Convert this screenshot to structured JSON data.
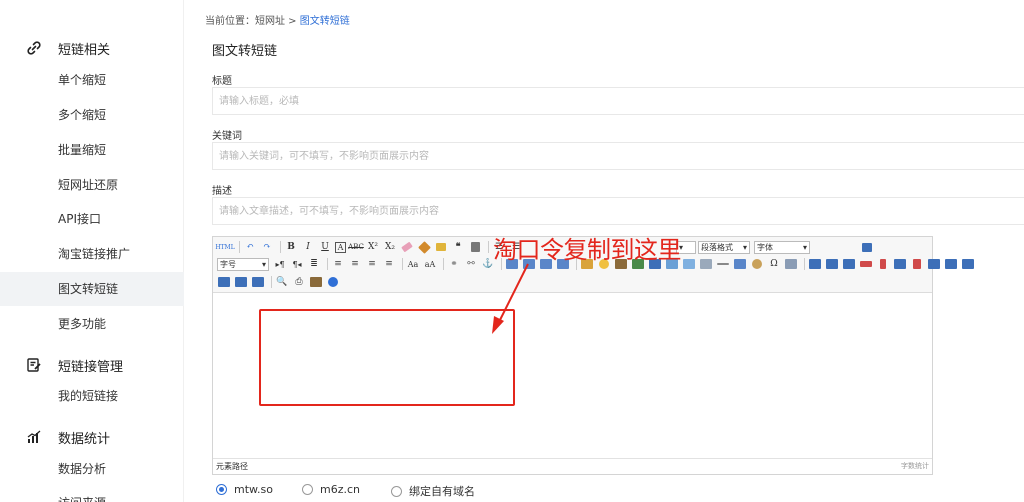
{
  "breadcrumb": {
    "prefix": "当前位置：",
    "parent": "短网址",
    "separator": " > ",
    "current": "图文转短链"
  },
  "sidebar": {
    "groups": [
      {
        "title": "短链相关",
        "icon": "link-icon",
        "items": [
          "单个缩短",
          "多个缩短",
          "批量缩短",
          "短网址还原",
          "API接口",
          "淘宝链接推广",
          "图文转短链",
          "更多功能"
        ]
      },
      {
        "title": "短链接管理",
        "icon": "edit-document-icon",
        "items": [
          "我的短链接"
        ]
      },
      {
        "title": "数据统计",
        "icon": "bar-chart-icon",
        "items": [
          "数据分析",
          "访问来源"
        ]
      }
    ],
    "active_item": "图文转短链"
  },
  "page_title": "图文转短链",
  "form": {
    "title_label": "标题",
    "title_placeholder": "请输入标题，必填",
    "keywords_label": "关键词",
    "keywords_placeholder": "请输入关键词，可不填写，不影响页面展示内容",
    "description_label": "描述",
    "description_placeholder": "请输入文章描述，可不填写，不影响页面展示内容"
  },
  "editor": {
    "toolbar": {
      "paragraph_select": "段落格式",
      "font_select": "字体",
      "size_select": "字号"
    },
    "status_left": "元素路径",
    "status_right": "字数统计"
  },
  "annotation": {
    "text": "淘口令复制到这里",
    "color": "#e3261c"
  },
  "domains": {
    "options": [
      "mtw.so",
      "m6z.cn",
      "绑定自有域名"
    ],
    "selected": "mtw.so"
  },
  "colors": {
    "accent": "#2f6fd6",
    "annotation": "#e3261c",
    "active_bg": "#f1f3f5"
  }
}
